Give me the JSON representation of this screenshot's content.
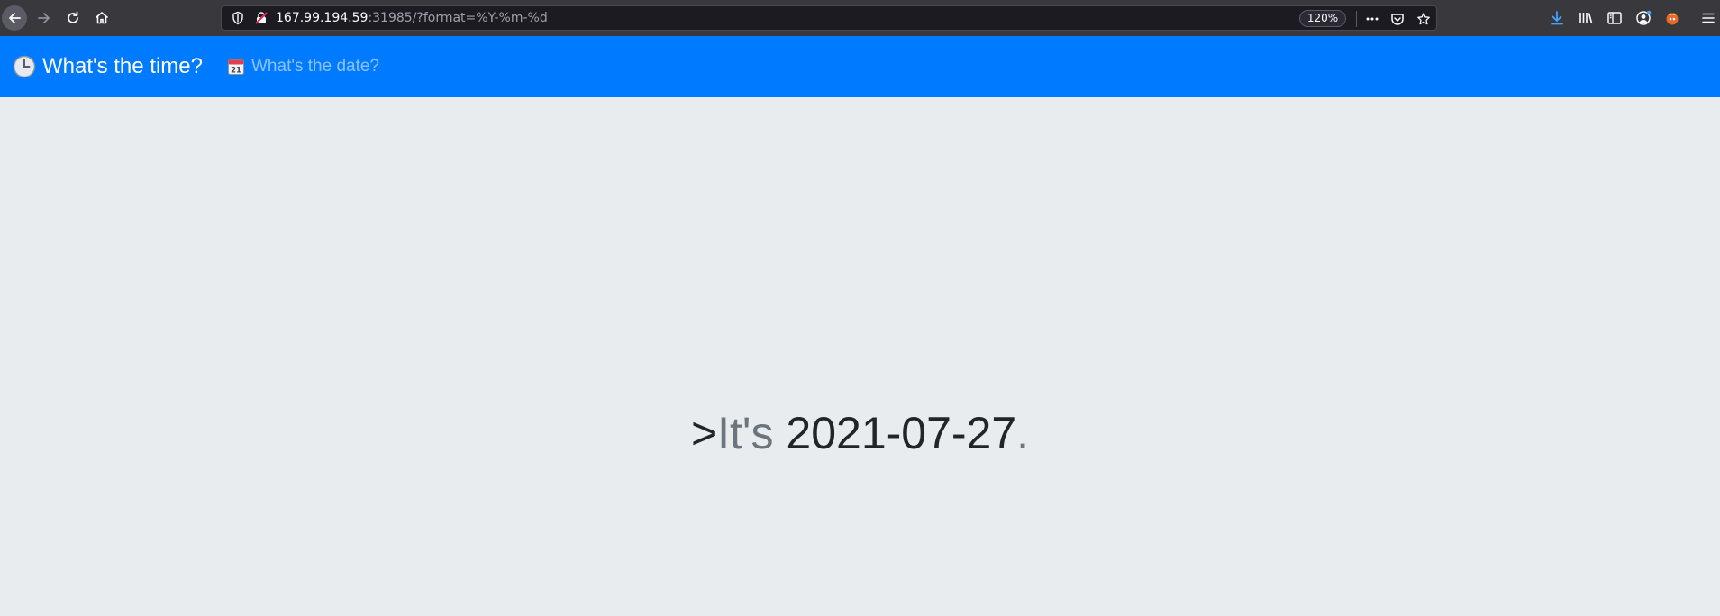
{
  "browser": {
    "url_host": "167.99.194.59",
    "url_rest": ":31985/?format=%Y-%m-%d",
    "zoom": "120%",
    "icons": {
      "back": "arrow-left-icon",
      "forward": "arrow-right-icon",
      "reload": "reload-icon",
      "home": "home-icon",
      "shield": "shield-icon",
      "insecure": "insecure-lock-icon",
      "more": "more-icon",
      "pocket": "pocket-icon",
      "bookmark": "star-icon",
      "download": "download-icon",
      "library": "library-icon",
      "sidebar": "sidebar-icon",
      "account": "account-icon",
      "extension": "extension-icon",
      "menu": "hamburger-menu-icon"
    },
    "colors": {
      "chrome": "#38383d",
      "urlbar": "#1c1b22",
      "download_accent": "#45a1ff"
    }
  },
  "navbar": {
    "brand_label": "What's the time?",
    "link_label": "What's the date?",
    "brand_icon": "clock-icon",
    "link_icon": "calendar-icon",
    "calendar_day": "21",
    "color": "#007bff"
  },
  "main": {
    "prefix": ">",
    "lead": "It's",
    "value": "2021-07-27",
    "suffix": ".",
    "background": "#e9ecef"
  }
}
